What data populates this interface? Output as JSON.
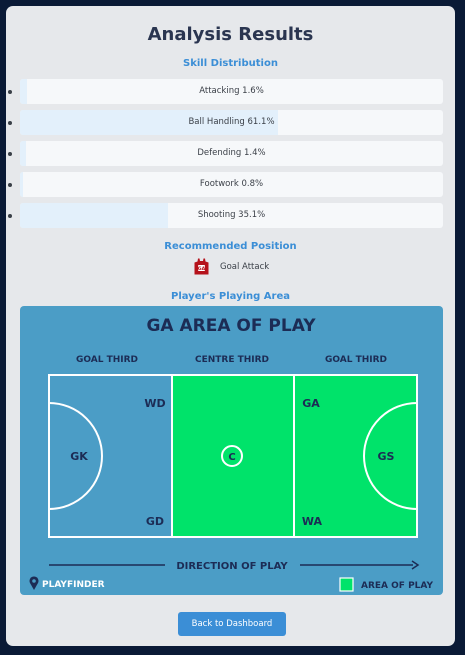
{
  "title": "Analysis Results",
  "skills": {
    "heading": "Skill Distribution",
    "items": [
      {
        "label": "Attacking 1.6%",
        "value": 1.6
      },
      {
        "label": "Ball Handling 61.1%",
        "value": 61.1
      },
      {
        "label": "Defending 1.4%",
        "value": 1.4
      },
      {
        "label": "Footwork 0.8%",
        "value": 0.8
      },
      {
        "label": "Shooting 35.1%",
        "value": 35.1
      }
    ]
  },
  "position": {
    "heading": "Recommended Position",
    "badge": "GA",
    "name": "Goal Attack",
    "icon": "jersey-icon"
  },
  "playing_area": {
    "heading": "Player's Playing Area",
    "image_title": "GA AREA OF PLAY",
    "thirds": [
      "GOAL THIRD",
      "CENTRE THIRD",
      "GOAL THIRD"
    ],
    "positions": {
      "wd": "WD",
      "gk": "GK",
      "gd": "GD",
      "c": "C",
      "ga": "GA",
      "gs": "GS",
      "wa": "WA"
    },
    "direction": "DIRECTION OF PLAY",
    "brand": "PLAYFINDER",
    "legend": "AREA OF PLAY",
    "colors": {
      "background": "#4b9dc6",
      "highlight": "#00e36a",
      "text": "#1c2c55"
    }
  },
  "back_button": "Back to Dashboard"
}
